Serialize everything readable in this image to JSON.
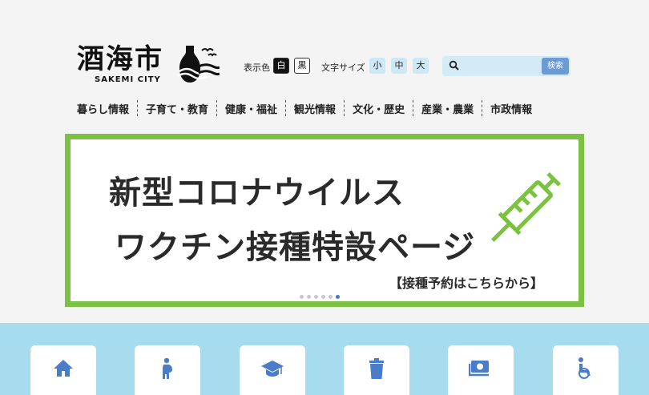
{
  "logo": {
    "title": "酒海市",
    "subtitle": "SAKEMI CITY"
  },
  "controls": {
    "color_label": "表示色",
    "color_white": "白",
    "color_black": "黒",
    "text_size_label": "文字サイズ",
    "size_small": "小",
    "size_medium": "中",
    "size_large": "大"
  },
  "search": {
    "placeholder": "",
    "button_label": "検索"
  },
  "nav": {
    "items": [
      {
        "label": "暮らし情報"
      },
      {
        "label": "子育て・教育"
      },
      {
        "label": "健康・福祉"
      },
      {
        "label": "観光情報"
      },
      {
        "label": "文化・歴史"
      },
      {
        "label": "産業・農業"
      },
      {
        "label": "市政情報"
      }
    ]
  },
  "banner": {
    "line1": "新型コロナウイルス",
    "line2": "ワクチン接種特設ページ",
    "line3": "【接種予約はこちらから】",
    "border_color": "#7cc242",
    "slide_count": 6,
    "active_slide": 6
  },
  "quick_links": {
    "icons": [
      "home-icon",
      "pregnant-person-icon",
      "graduation-cap-icon",
      "trash-icon",
      "money-icon",
      "wheelchair-icon"
    ],
    "icon_color": "#4a7cc9",
    "background": "#a7dcef"
  }
}
